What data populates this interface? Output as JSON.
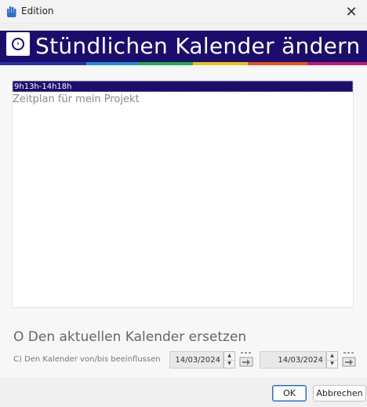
{
  "window": {
    "title": "Edition",
    "close_symbol": "✕",
    "app_icon": "hand-icon"
  },
  "banner": {
    "title": "Stündlichen Kalender ändern",
    "icon": "circle-arrow-icon",
    "icon_glyph": "›",
    "background_color": "#1b0d6e",
    "stripe_colors": [
      "#2b2fa8",
      "#1a8fd4",
      "#1bb04a",
      "#e8c31a",
      "#e8551a",
      "#c01a7a"
    ]
  },
  "schedule_list": {
    "items": [
      {
        "label": "9h13h-14h18h",
        "selected": true
      },
      {
        "label": "Zeitplan für mein Projekt",
        "selected": false
      }
    ]
  },
  "options": {
    "replace_label": "O Den aktuellen Kalender ersetzen",
    "affect_label": "C) Den Kalender von/bis beeinflussen"
  },
  "date_from": {
    "value": "14/03/2024"
  },
  "date_to": {
    "value": "14/03/2024"
  },
  "buttons": {
    "ok": "OK",
    "cancel": "Abbrechen"
  }
}
